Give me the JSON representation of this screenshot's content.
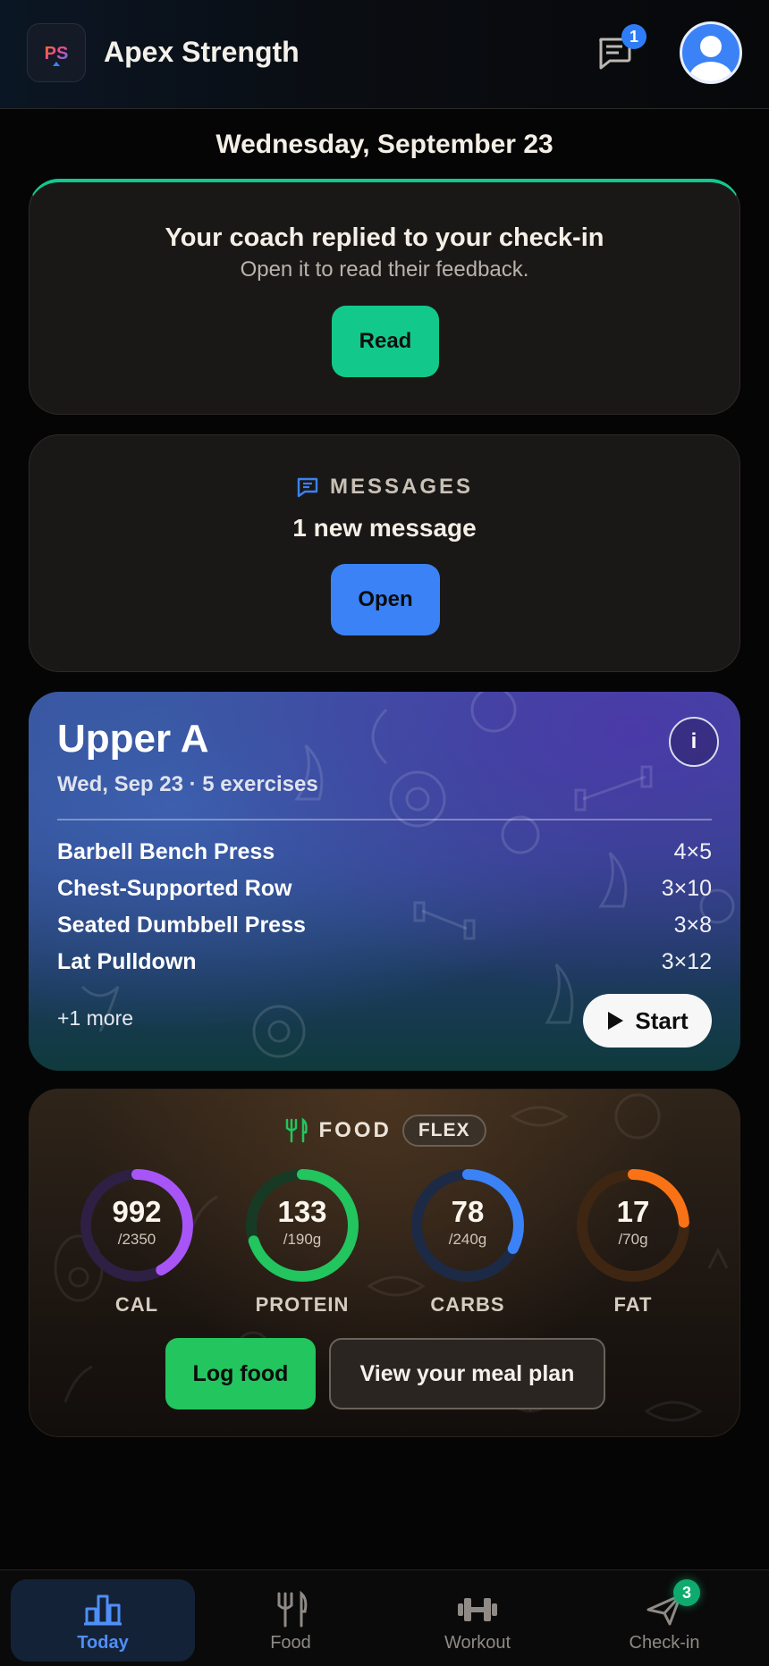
{
  "header": {
    "app_title": "Apex Strength",
    "logo_text": "PS",
    "messages_badge": "1"
  },
  "date_heading": "Wednesday, September 23",
  "coach_card": {
    "title": "Your coach replied to your check-in",
    "subtitle": "Open it to read their feedback.",
    "button_label": "Read",
    "accent_color": "#10c98c"
  },
  "messages_card": {
    "label": "MESSAGES",
    "count_text": "1 new message",
    "button_label": "Open"
  },
  "workout": {
    "name": "Upper A",
    "meta": "Wed, Sep 23 · 5 exercises",
    "info_label": "i",
    "exercises": [
      {
        "name": "Barbell Bench Press",
        "sets": "4×5"
      },
      {
        "name": "Chest-Supported Row",
        "sets": "3×10"
      },
      {
        "name": "Seated Dumbbell Press",
        "sets": "3×8"
      },
      {
        "name": "Lat Pulldown",
        "sets": "3×12"
      }
    ],
    "more_text": "+1 more",
    "start_label": "Start"
  },
  "food": {
    "label": "FOOD",
    "mode_pill": "FLEX",
    "macros": [
      {
        "value": "992",
        "target": "/2350",
        "label": "CAL",
        "progress": 0.42,
        "color": "#a855f7",
        "track": "#2e1f44"
      },
      {
        "value": "133",
        "target": "/190g",
        "label": "PROTEIN",
        "progress": 0.7,
        "color": "#22c55e",
        "track": "#173a24"
      },
      {
        "value": "78",
        "target": "/240g",
        "label": "CARBS",
        "progress": 0.325,
        "color": "#3b82f6",
        "track": "#1d2a45"
      },
      {
        "value": "17",
        "target": "/70g",
        "label": "FAT",
        "progress": 0.24,
        "color": "#f97316",
        "track": "#3f2612"
      }
    ],
    "log_button": "Log food",
    "plan_button": "View your meal plan"
  },
  "nav": {
    "items": [
      {
        "label": "Today",
        "icon": "bar-chart-icon",
        "active": true
      },
      {
        "label": "Food",
        "icon": "fork-knife-icon",
        "active": false
      },
      {
        "label": "Workout",
        "icon": "dumbbell-icon",
        "active": false
      },
      {
        "label": "Check-in",
        "icon": "send-icon",
        "active": false,
        "badge": "3"
      }
    ]
  }
}
